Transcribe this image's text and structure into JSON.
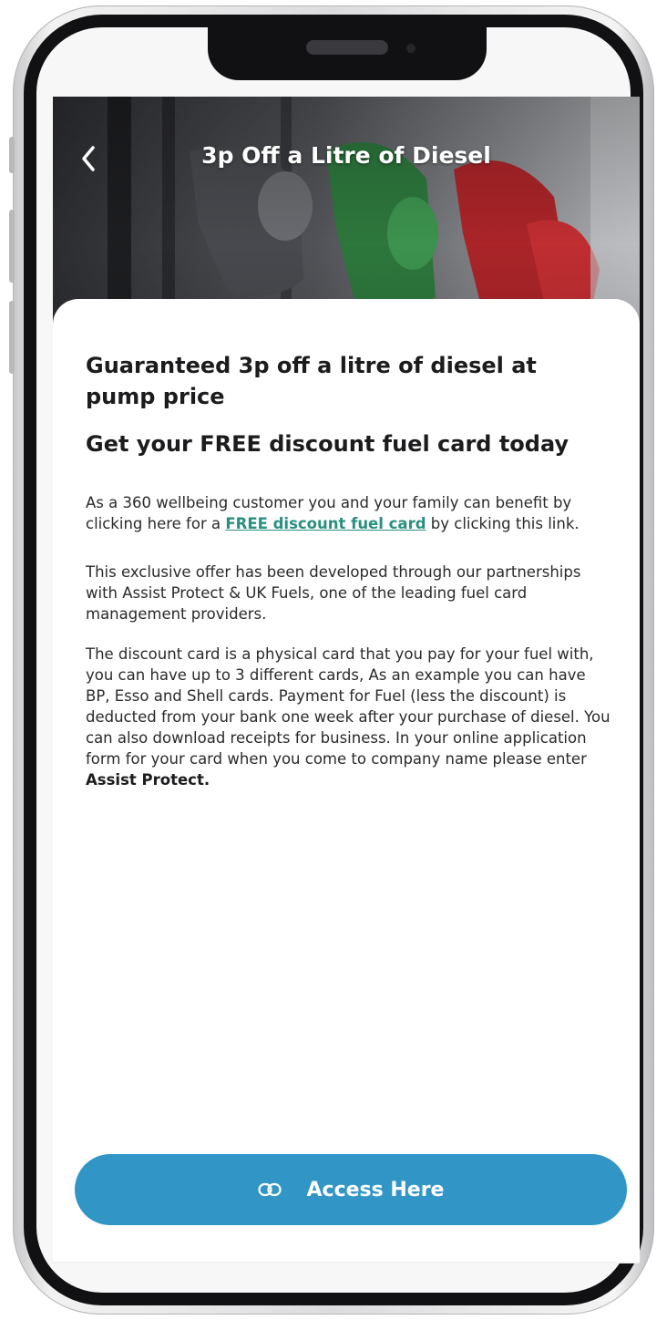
{
  "header": {
    "title": "3p Off a Litre of Diesel",
    "back_icon": "chevron-left-icon"
  },
  "content": {
    "headline": "Guaranteed 3p off a litre of diesel at pump price",
    "subheadline": "Get your FREE discount fuel card today",
    "paragraph1": {
      "before_link": "As a 360 wellbeing customer you and your family can benefit by clicking here for a ",
      "link_text": "FREE discount fuel card",
      "after_link": " by clicking this link."
    },
    "paragraph2": "This exclusive offer has been developed through our partnerships with Assist Protect & UK Fuels, one of the leading fuel card management providers.",
    "paragraph3": {
      "text": "The discount card is a physical card that you pay for your fuel with, you can have up to 3 different cards, As an example you can have BP, Esso and Shell cards. Payment for Fuel (less the discount) is deducted from your bank one week after your purchase of diesel. You can also download receipts for business. In your online application form for your card when you come to company name please enter ",
      "bold_text": "Assist Protect."
    }
  },
  "cta": {
    "label": "Access Here",
    "icon": "link-icon"
  },
  "colors": {
    "accent": "#3196c6",
    "link": "#2a8f7f"
  }
}
